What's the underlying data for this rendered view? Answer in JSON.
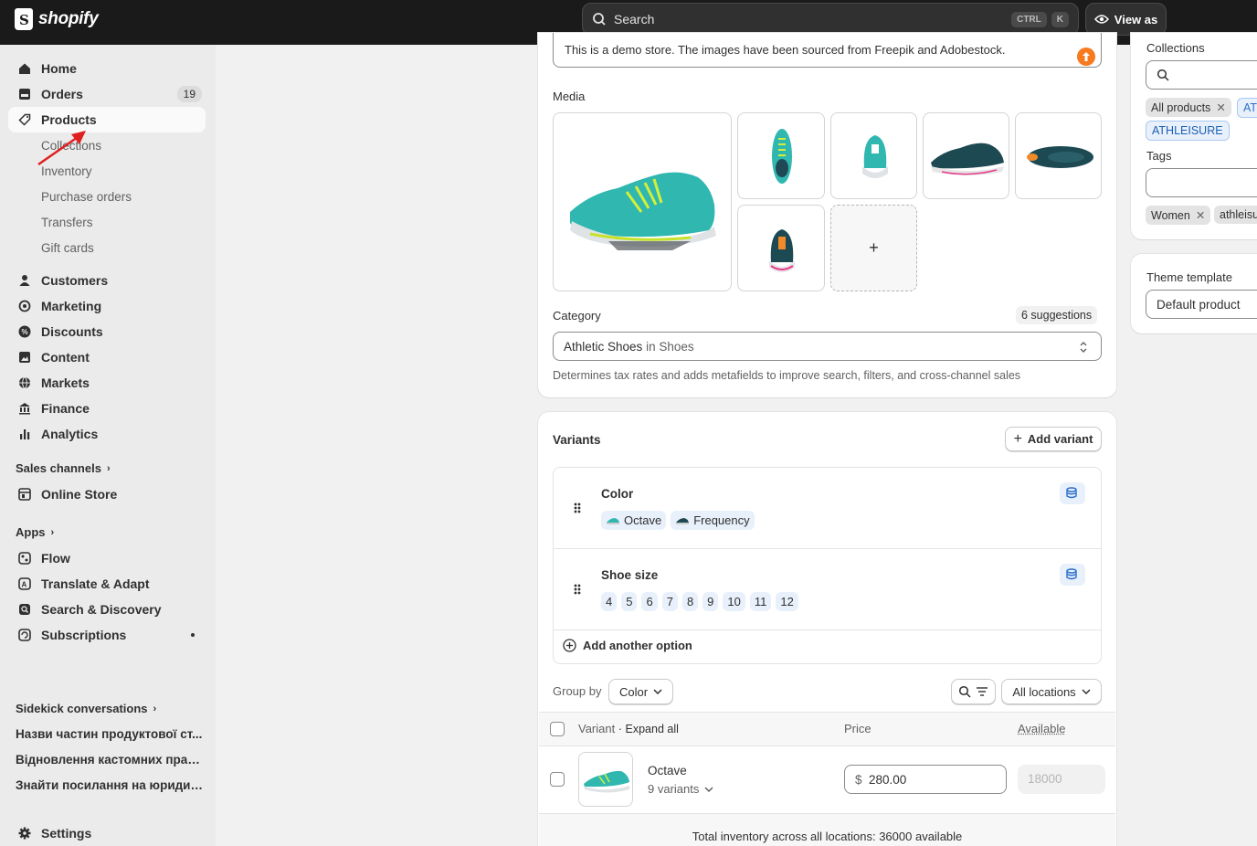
{
  "topbar": {
    "logo": "shopify",
    "search_placeholder": "Search",
    "kbd_ctrl": "CTRL",
    "kbd_k": "K",
    "view_as": "View as"
  },
  "sidebar": {
    "items": [
      {
        "label": "Home",
        "icon": "home-icon"
      },
      {
        "label": "Orders",
        "icon": "orders-icon",
        "badge": "19"
      },
      {
        "label": "Products",
        "icon": "tag-icon",
        "active": true
      }
    ],
    "product_sub": [
      "Collections",
      "Inventory",
      "Purchase orders",
      "Transfers",
      "Gift cards"
    ],
    "items2": [
      {
        "label": "Customers",
        "icon": "person-icon"
      },
      {
        "label": "Marketing",
        "icon": "target-icon"
      },
      {
        "label": "Discounts",
        "icon": "discount-icon"
      },
      {
        "label": "Content",
        "icon": "content-icon"
      },
      {
        "label": "Markets",
        "icon": "globe-icon"
      },
      {
        "label": "Finance",
        "icon": "bank-icon"
      },
      {
        "label": "Analytics",
        "icon": "chart-icon"
      }
    ],
    "sales_channels": "Sales channels",
    "online_store": "Online Store",
    "apps": "Apps",
    "apps_items": [
      "Flow",
      "Translate & Adapt",
      "Search & Discovery",
      "Subscriptions"
    ],
    "sidekick": "Sidekick conversations",
    "conversations": [
      "Назви частин продуктової ст...",
      "Відновлення кастомних прав...",
      "Знайти посилання на юридич..."
    ],
    "settings": "Settings"
  },
  "description": {
    "text": "This is a demo store. The images have been sourced from Freepik and Adobestock."
  },
  "media": {
    "label": "Media",
    "add": "+"
  },
  "category": {
    "label": "Category",
    "suggestions": "6 suggestions",
    "value_main": "Athletic Shoes",
    "value_in": " in Shoes",
    "help": "Determines tax rates and adds metafields to improve search, filters, and cross-channel sales"
  },
  "variants": {
    "title": "Variants",
    "add_variant": "Add variant",
    "options": [
      {
        "name": "Color",
        "values": [
          "Octave",
          "Frequency"
        ]
      },
      {
        "name": "Shoe size",
        "values": [
          "4",
          "5",
          "6",
          "7",
          "8",
          "9",
          "10",
          "11",
          "12"
        ]
      }
    ],
    "add_option": "Add another option",
    "group_by_label": "Group by",
    "group_by_value": "Color",
    "locations": "All locations",
    "table": {
      "col_variant": "Variant",
      "expand": "· Expand all",
      "col_price": "Price",
      "col_available": "Available"
    },
    "row": {
      "name": "Octave",
      "count": "9 variants",
      "currency": "$",
      "price": "280.00",
      "available": "18000"
    },
    "total": "Total inventory across all locations: 36000 available"
  },
  "right": {
    "collections_label": "Collections",
    "collection_tags": [
      "All products",
      "ATHLEISURE"
    ],
    "collection_tag_cut": "AT",
    "tags_label": "Tags",
    "tags": [
      "Women"
    ],
    "tag_cut": "athleisu",
    "theme_label": "Theme template",
    "theme_value": "Default product"
  }
}
